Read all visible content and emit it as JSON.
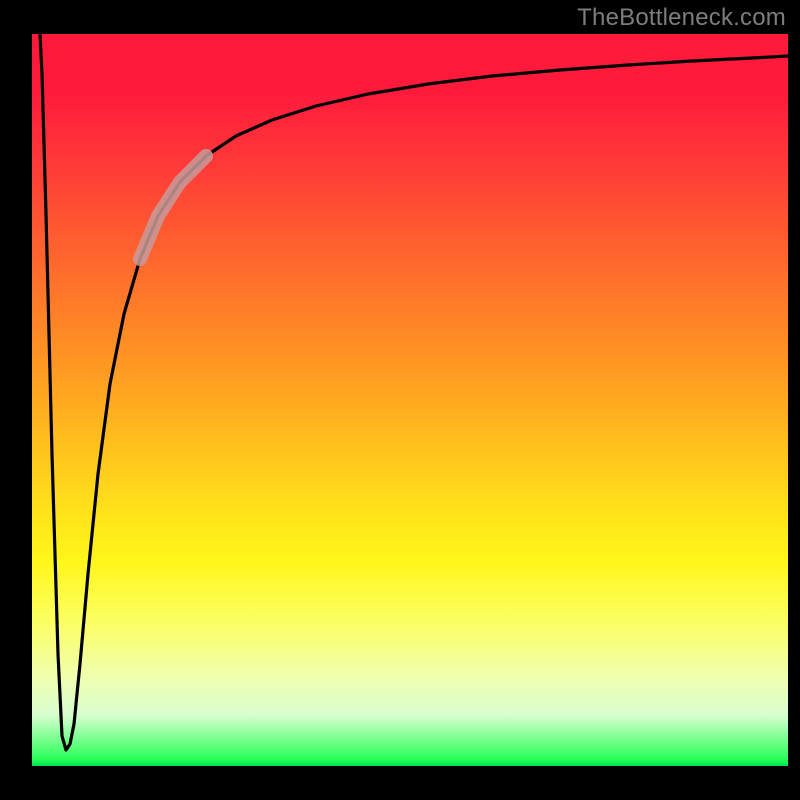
{
  "watermark": "TheBottleneck.com",
  "colors": {
    "curve": "#000000",
    "highlight": "#c89a9a",
    "gradient_top": "#ff1a3c",
    "gradient_mid": "#ffe51a",
    "gradient_bottom": "#00e24c",
    "frame": "#000000"
  },
  "chart_data": {
    "type": "line",
    "title": "",
    "xlabel": "",
    "ylabel": "",
    "xlim": [
      0,
      100
    ],
    "ylim": [
      0,
      100
    ],
    "grid": false,
    "legend": false,
    "annotations": [
      "TheBottleneck.com"
    ],
    "series": [
      {
        "name": "bottleneck-curve",
        "x": [
          0,
          1,
          2,
          3,
          4,
          5,
          6,
          7,
          8,
          10,
          12,
          14,
          16,
          18,
          20,
          22,
          25,
          30,
          35,
          40,
          50,
          60,
          70,
          80,
          90,
          100
        ],
        "y": [
          100,
          50,
          10,
          2,
          4,
          18,
          32,
          44,
          52,
          62,
          68,
          73,
          77,
          80,
          82,
          83.5,
          85,
          87,
          88.5,
          89.5,
          91,
          92,
          92.8,
          93.4,
          93.8,
          94.1
        ]
      },
      {
        "name": "highlight-segment",
        "x": [
          14,
          16,
          18,
          20,
          22,
          24
        ],
        "y": [
          73,
          77,
          80,
          82,
          83.5,
          84.5
        ]
      }
    ]
  }
}
